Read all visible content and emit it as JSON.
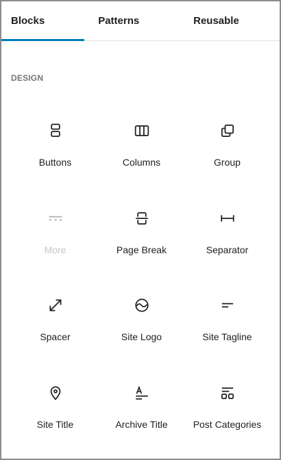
{
  "tabs": [
    {
      "label": "Blocks",
      "active": true
    },
    {
      "label": "Patterns",
      "active": false
    },
    {
      "label": "Reusable",
      "active": false
    }
  ],
  "section": {
    "title": "DESIGN"
  },
  "blocks": [
    {
      "label": "Buttons",
      "icon": "buttons-icon",
      "disabled": false
    },
    {
      "label": "Columns",
      "icon": "columns-icon",
      "disabled": false
    },
    {
      "label": "Group",
      "icon": "group-icon",
      "disabled": false
    },
    {
      "label": "More",
      "icon": "more-icon",
      "disabled": true
    },
    {
      "label": "Page Break",
      "icon": "page-break-icon",
      "disabled": false
    },
    {
      "label": "Separator",
      "icon": "separator-icon",
      "disabled": false
    },
    {
      "label": "Spacer",
      "icon": "spacer-icon",
      "disabled": false
    },
    {
      "label": "Site Logo",
      "icon": "site-logo-icon",
      "disabled": false
    },
    {
      "label": "Site Tagline",
      "icon": "site-tagline-icon",
      "disabled": false
    },
    {
      "label": "Site Title",
      "icon": "site-title-icon",
      "disabled": false
    },
    {
      "label": "Archive Title",
      "icon": "archive-title-icon",
      "disabled": false
    },
    {
      "label": "Post Categories",
      "icon": "post-categories-icon",
      "disabled": false
    }
  ],
  "colors": {
    "accent": "#007cba",
    "text": "#1e1e1e",
    "muted": "#757575",
    "disabled": "#c4c4c4",
    "border": "#8c8c8c"
  }
}
